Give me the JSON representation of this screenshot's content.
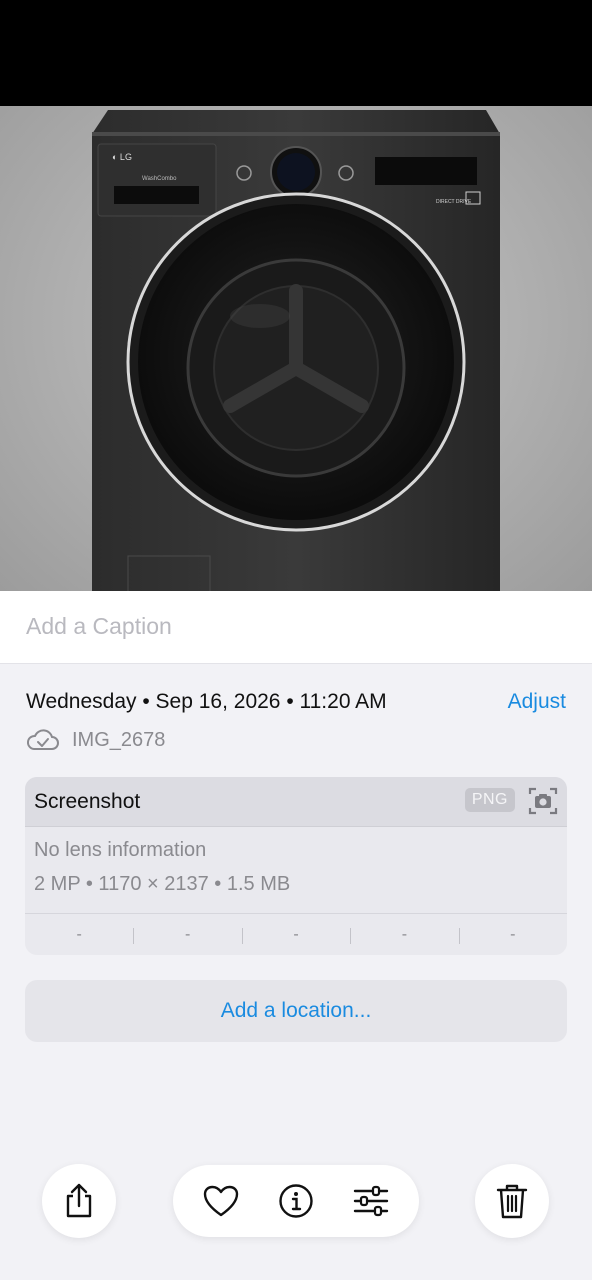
{
  "photo": {
    "brand_text": "LG",
    "model_text": "WashCombo"
  },
  "caption": {
    "placeholder": "Add a Caption"
  },
  "meta": {
    "datetime": "Wednesday • Sep 16, 2026 • 11:20 AM",
    "adjust_label": "Adjust",
    "file_name": "IMG_2678"
  },
  "info": {
    "title": "Screenshot",
    "format_badge": "PNG",
    "lens": "No lens information",
    "specs": "2 MP • 1170 × 2137 • 1.5 MB",
    "exif": [
      "-",
      "-",
      "-",
      "-",
      "-"
    ]
  },
  "location": {
    "label": "Add a location..."
  },
  "toolbar": {
    "share_icon": "share-icon",
    "favorite_icon": "heart-icon",
    "info_icon": "info-icon",
    "adjust_icon": "sliders-icon",
    "delete_icon": "trash-icon"
  },
  "colors": {
    "accent": "#1a8be0",
    "secondary_text": "#8a8a8f"
  }
}
